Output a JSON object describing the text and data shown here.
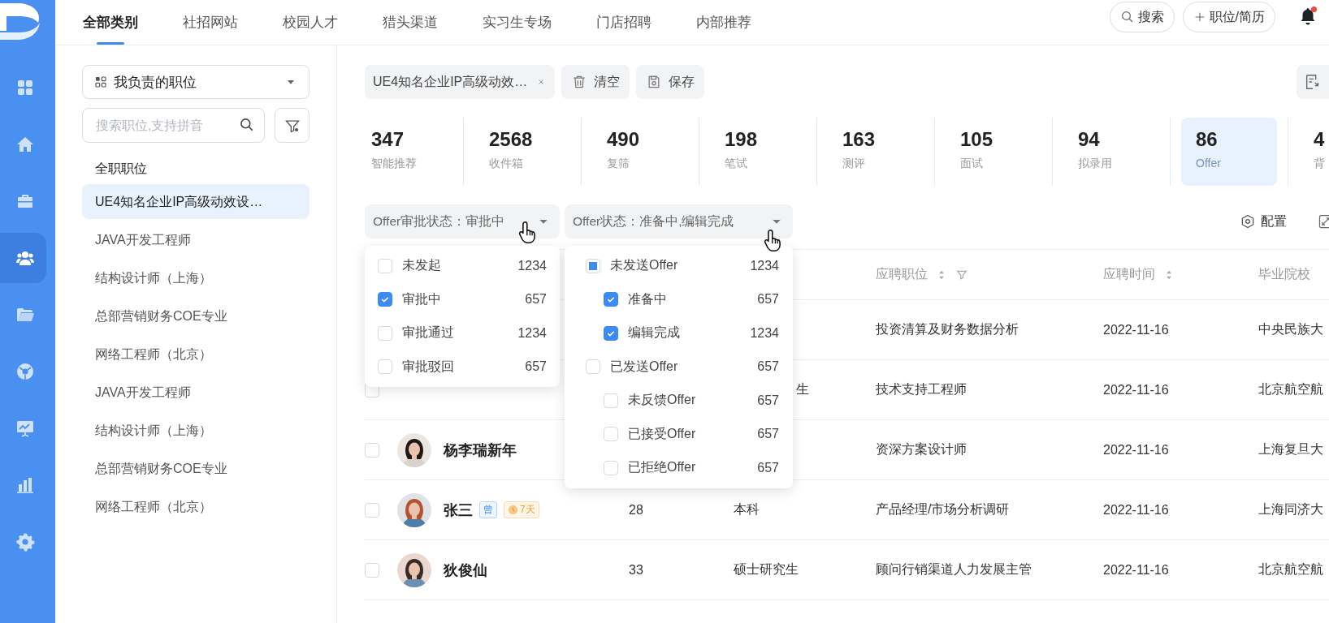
{
  "rail": {
    "items": [
      {
        "kind": "grid",
        "selected": false
      },
      {
        "kind": "home",
        "selected": false
      },
      {
        "kind": "briefcase",
        "selected": false
      },
      {
        "kind": "people",
        "selected": true
      },
      {
        "kind": "folder",
        "selected": false
      },
      {
        "kind": "globe",
        "selected": false
      },
      {
        "kind": "board",
        "selected": false
      },
      {
        "kind": "bars",
        "selected": false
      },
      {
        "kind": "gear",
        "selected": false
      }
    ]
  },
  "nav": {
    "tabs": [
      {
        "label": "全部类别",
        "selected": true
      },
      {
        "label": "社招网站",
        "selected": false
      },
      {
        "label": "校园人才",
        "selected": false
      },
      {
        "label": "猎头渠道",
        "selected": false
      },
      {
        "label": "实习生专场",
        "selected": false
      },
      {
        "label": "门店招聘",
        "selected": false
      },
      {
        "label": "内部推荐",
        "selected": false
      }
    ],
    "search_button": "搜索",
    "add_button": "职位/简历",
    "notifications": {
      "unread": true
    }
  },
  "job_panel": {
    "scope_select": "我负责的职位",
    "search": {
      "placeholder": "搜索职位,支持拼音"
    },
    "heading": "全职职位",
    "jobs": [
      {
        "label": "UE4知名企业IP高级动效设…",
        "selected": true
      },
      {
        "label": "JAVA开发工程师",
        "selected": false
      },
      {
        "label": "结构设计师（上海）",
        "selected": false
      },
      {
        "label": "总部营销财务COE专业",
        "selected": false
      },
      {
        "label": "网络工程师（北京）",
        "selected": false
      },
      {
        "label": "JAVA开发工程师",
        "selected": false
      },
      {
        "label": "结构设计师（上海）",
        "selected": false
      },
      {
        "label": "总部营销财务COE专业",
        "selected": false
      },
      {
        "label": "网络工程师（北京）",
        "selected": false
      }
    ]
  },
  "toolbar": {
    "filter_tag": "UE4知名企业IP高级动效…",
    "clear_button": "清空",
    "save_button": "保存"
  },
  "stages": [
    {
      "count": "347",
      "label": "智能推荐",
      "selected": false
    },
    {
      "count": "2568",
      "label": "收件箱",
      "selected": false
    },
    {
      "count": "490",
      "label": "复筛",
      "selected": false
    },
    {
      "count": "198",
      "label": "笔试",
      "selected": false
    },
    {
      "count": "163",
      "label": "测评",
      "selected": false
    },
    {
      "count": "105",
      "label": "面试",
      "selected": false
    },
    {
      "count": "94",
      "label": "拟录用",
      "selected": false
    },
    {
      "count": "86",
      "label": "Offer",
      "selected": true
    },
    {
      "count": "4",
      "label": "背",
      "selected": false
    }
  ],
  "filters": [
    {
      "label": "Offer审批状态：",
      "value": "审批中",
      "options": [
        {
          "label": "未发起",
          "count": "1234",
          "checked": false
        },
        {
          "label": "审批中",
          "count": "657",
          "checked": true
        },
        {
          "label": "审批通过",
          "count": "1234",
          "checked": false
        },
        {
          "label": "审批驳回",
          "count": "657",
          "checked": false
        }
      ]
    },
    {
      "label": "Offer状态：",
      "value": "准备中,编辑完成",
      "options": [
        {
          "label": "未发送Offer",
          "count": "1234",
          "checked": false,
          "indeterminate": true,
          "children": [
            {
              "label": "准备中",
              "count": "657",
              "checked": true
            },
            {
              "label": "编辑完成",
              "count": "1234",
              "checked": true
            }
          ]
        },
        {
          "label": "已发送Offer",
          "count": "657",
          "checked": false,
          "indeterminate": false,
          "children": [
            {
              "label": "未反馈Offer",
              "count": "657",
              "checked": false
            },
            {
              "label": "已接受Offer",
              "count": "657",
              "checked": false
            },
            {
              "label": "已拒绝Offer",
              "count": "657",
              "checked": false
            }
          ]
        }
      ]
    }
  ],
  "config_button": "配置",
  "table": {
    "columns": [
      {
        "label": "应聘职位",
        "sortable": true,
        "filterable": true
      },
      {
        "label": "应聘时间",
        "sortable": true,
        "filterable": false
      },
      {
        "label": "毕业院校",
        "sortable": false,
        "filterable": false
      }
    ],
    "rows": [
      {
        "position": "投资清算及财务数据分析",
        "time": "2022-11-16",
        "school": "中央民族大"
      },
      {
        "checked": false,
        "education": "生",
        "partly_covered": true,
        "position": "技术支持工程师",
        "time": "2022-11-16",
        "school": "北京航空航"
      },
      {
        "checked": false,
        "avatar": {
          "kind": "picture"
        },
        "name": "杨李瑞新年",
        "position": "资深方案设计师",
        "time": "2022-11-16",
        "school": "上海复旦大"
      },
      {
        "checked": false,
        "avatar": {
          "kind": "picture"
        },
        "name": "张三",
        "tags": [
          {
            "kind": "mark",
            "text": "曾"
          },
          {
            "kind": "timer",
            "text": "7天"
          }
        ],
        "age": "28",
        "education": "本科",
        "position": "产品经理/市场分析调研",
        "time": "2022-11-16",
        "school": "上海同济大"
      },
      {
        "checked": false,
        "avatar": {
          "kind": "picture"
        },
        "name": "狄俊仙",
        "age": "33",
        "education": "硕士研究生",
        "position": "顾问行销渠道人力发展主管",
        "time": "2022-11-16",
        "school": "北京航空航"
      }
    ]
  }
}
